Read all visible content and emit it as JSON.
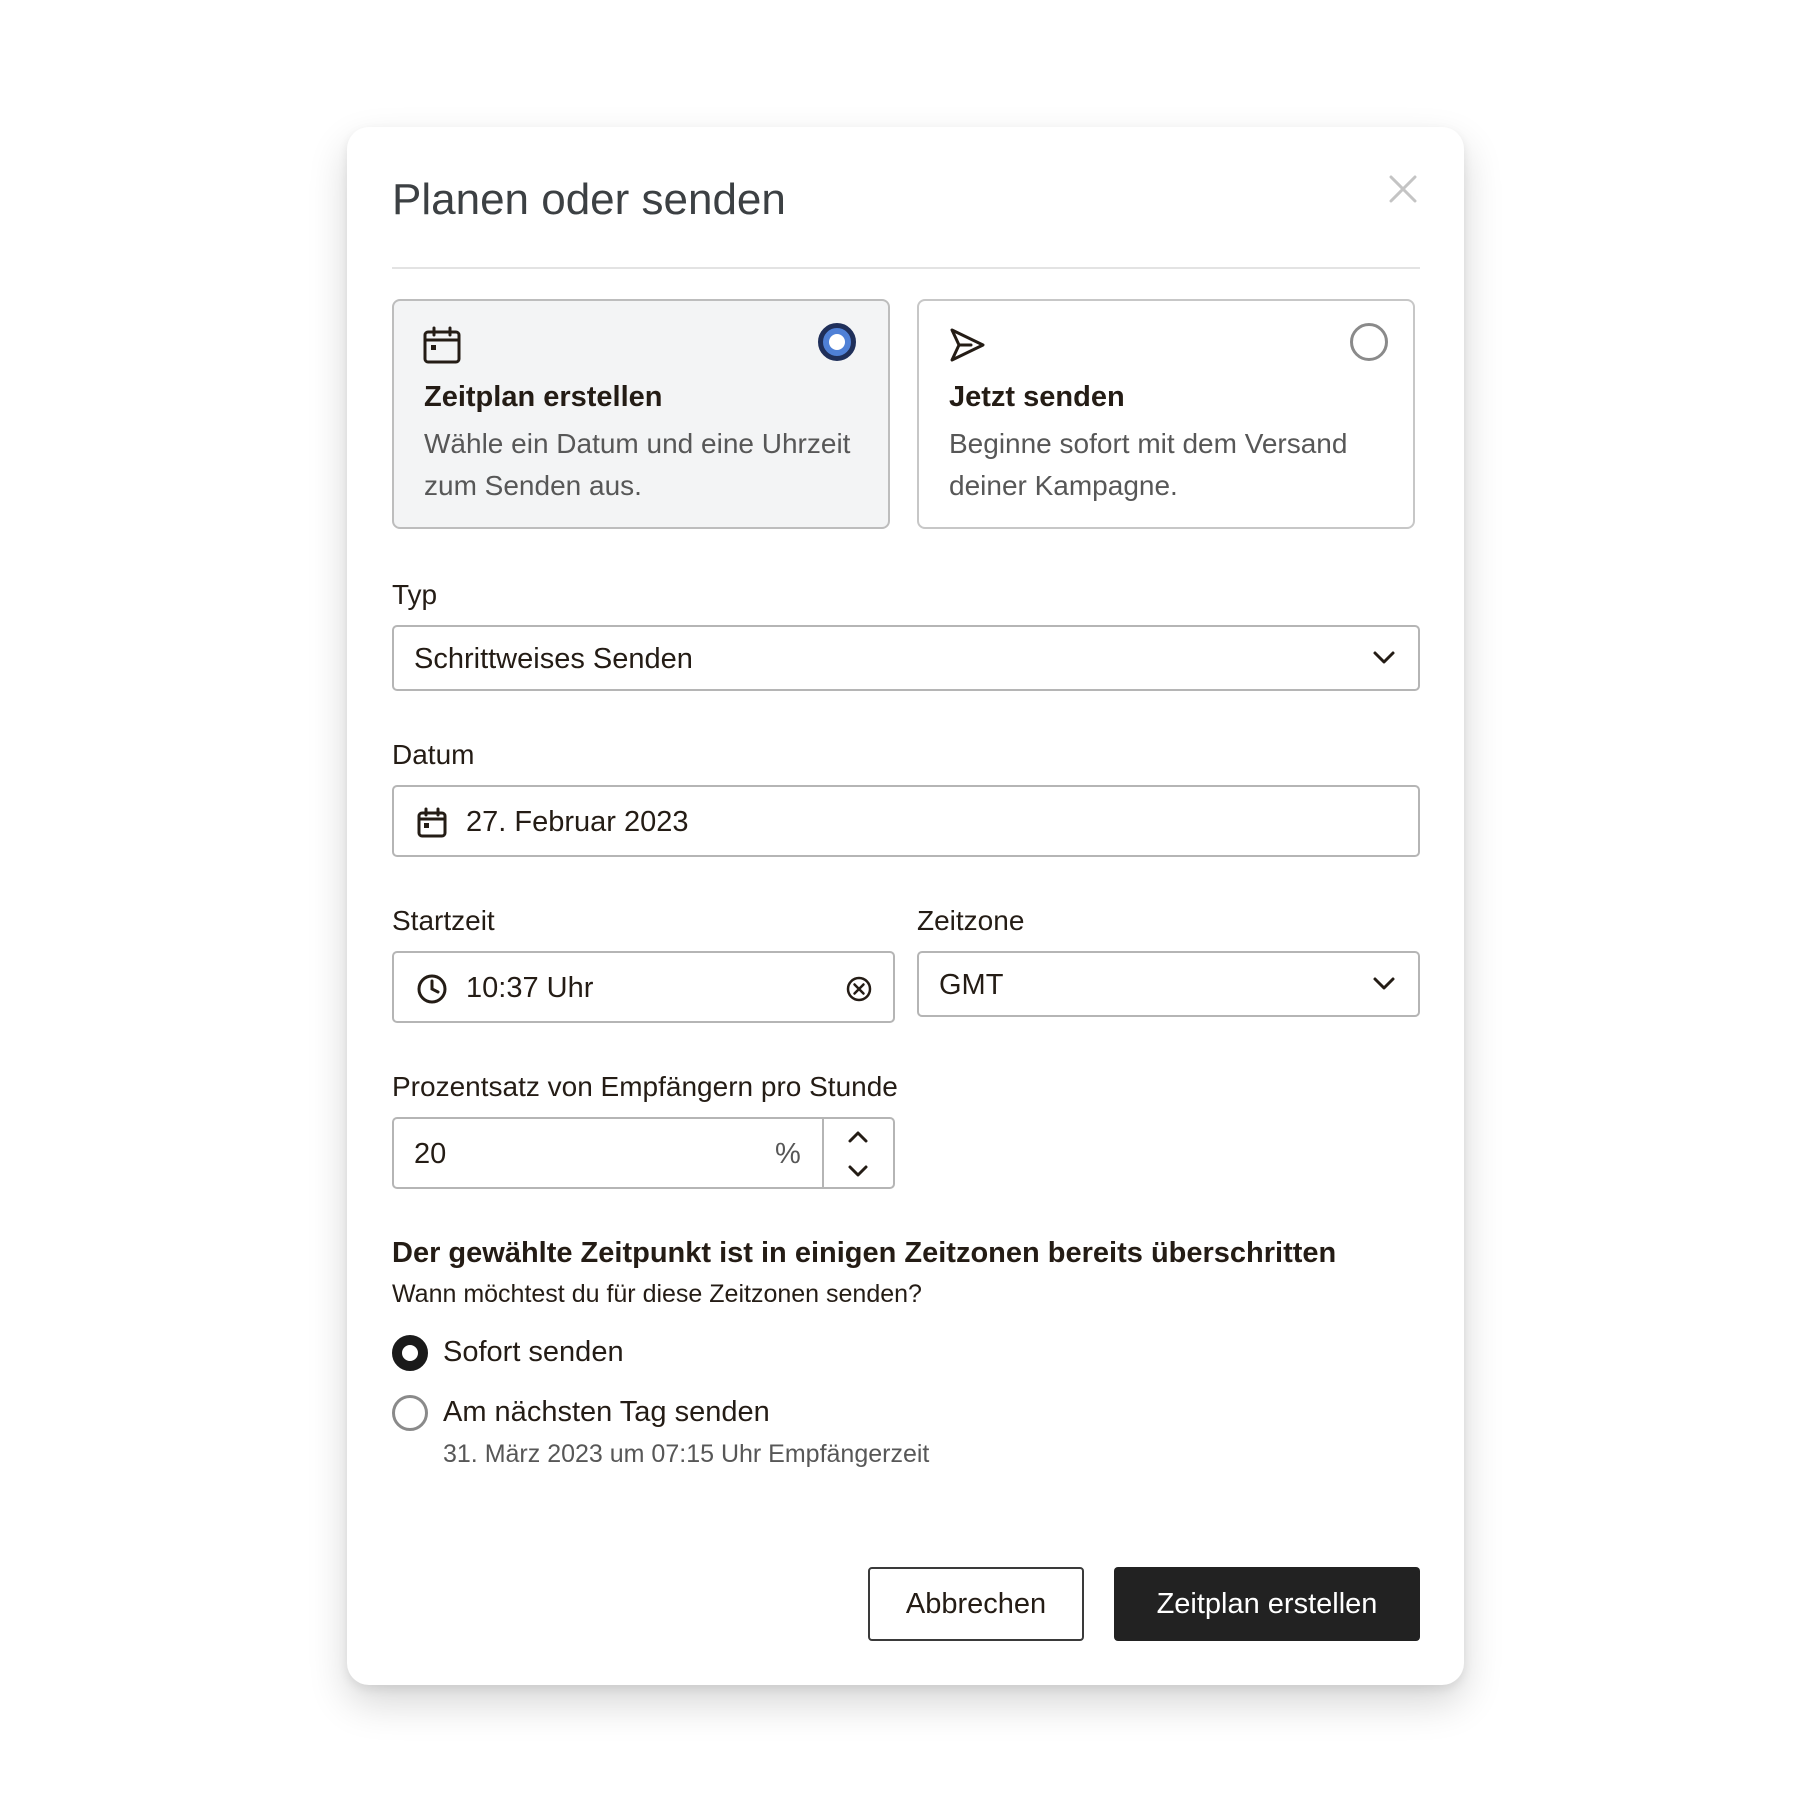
{
  "dialog": {
    "title": "Planen oder senden"
  },
  "options": [
    {
      "title": "Zeitplan erstellen",
      "description": "Wähle ein Datum und eine Uhrzeit zum Senden aus.",
      "icon": "calendar-icon",
      "selected": true
    },
    {
      "title": "Jetzt senden",
      "description": "Beginne sofort mit dem Versand deiner Kampagne.",
      "icon": "send-icon",
      "selected": false
    }
  ],
  "type": {
    "label": "Typ",
    "value": "Schrittweises Senden"
  },
  "date": {
    "label": "Datum",
    "value": "27. Februar 2023"
  },
  "start_time": {
    "label": "Startzeit",
    "value": "10:37 Uhr"
  },
  "timezone": {
    "label": "Zeitzone",
    "value": "GMT"
  },
  "percentage": {
    "label": "Prozentsatz von Empfängern pro Stunde",
    "value": "20",
    "unit": "%"
  },
  "notice": {
    "heading": "Der gewählte Zeitpunkt ist in einigen Zeitzonen bereits überschritten",
    "question": "Wann möchtest du für diese Zeitzonen senden?",
    "choices": [
      {
        "label": "Sofort senden",
        "selected": true,
        "hint": ""
      },
      {
        "label": "Am nächsten Tag senden",
        "selected": false,
        "hint": "31. März 2023 um 07:15 Uhr Empfängerzeit"
      }
    ]
  },
  "buttons": {
    "cancel": "Abbrechen",
    "submit": "Zeitplan erstellen"
  },
  "colors": {
    "primary_button": "#222222",
    "selected_radio": "#4f80d6",
    "selected_card_bg": "#f3f4f5"
  }
}
